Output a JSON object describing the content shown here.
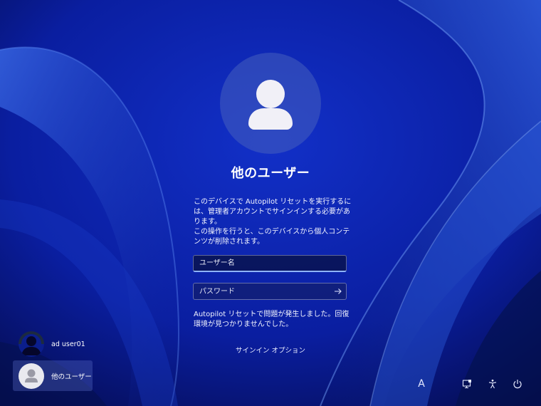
{
  "login": {
    "title": "他のユーザー",
    "message1": "このデバイスで Autopilot リセットを実行するには、管理者アカウントでサインインする必要があります。",
    "message2": "この操作を行うと、このデバイスから個人コンテンツが削除されます。",
    "username_placeholder": "ユーザー名",
    "username_value": "",
    "password_placeholder": "パスワード",
    "error": "Autopilot リセットで問題が発生しました。回復環境が見つかりませんでした。",
    "signin_options": "サインイン オプション"
  },
  "users": [
    {
      "name": "ad user01"
    },
    {
      "name": "他のユーザー"
    }
  ],
  "tray": {
    "ime_label": "A",
    "icons": [
      "network-icon",
      "accessibility-icon",
      "power-icon"
    ]
  },
  "colors": {
    "background": "#0a1a8a",
    "accent": "#8fb4ff"
  }
}
